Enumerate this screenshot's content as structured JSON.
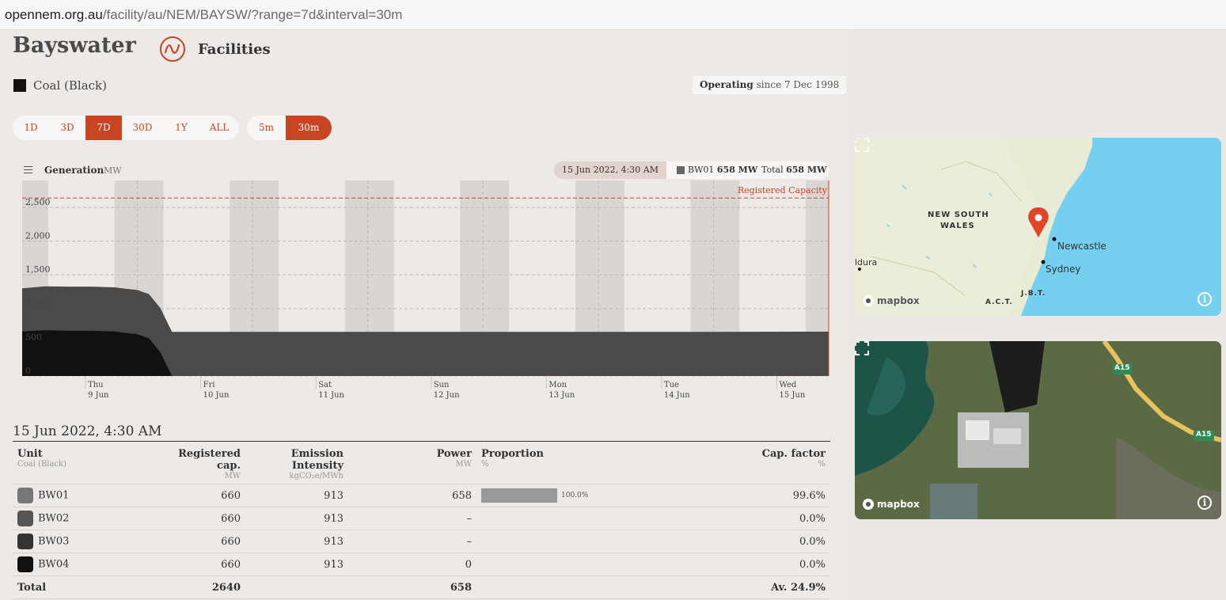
{
  "browser": {
    "url_host": "opennem.org.au",
    "url_path": "/facility/au/NEM/BAYSW/?range=7d&interval=30m"
  },
  "facility": {
    "name": "Bayswater",
    "nav_label": "Facilities",
    "fuel_tech": "Coal (Black)",
    "status": "Operating",
    "since": "since 7 Dec 1998"
  },
  "ranges": [
    "1D",
    "3D",
    "7D",
    "30D",
    "1Y",
    "ALL"
  ],
  "active_range": "7D",
  "intervals": [
    "5m",
    "30m"
  ],
  "active_interval": "30m",
  "chart_header": {
    "title": "Generation",
    "unit": "MW",
    "hover_date": "15 Jun 2022, 4:30 AM",
    "hover_unit": "BW01",
    "hover_unit_value": "658 MW",
    "hover_total_label": "Total",
    "hover_total_value": "658 MW"
  },
  "chart_data": {
    "type": "area",
    "x_ticks": [
      {
        "day": "Thu",
        "date": "9 Jun"
      },
      {
        "day": "Fri",
        "date": "10 Jun"
      },
      {
        "day": "Sat",
        "date": "11 Jun"
      },
      {
        "day": "Sun",
        "date": "12 Jun"
      },
      {
        "day": "Mon",
        "date": "13 Jun"
      },
      {
        "day": "Tue",
        "date": "14 Jun"
      },
      {
        "day": "Wed",
        "date": "15 Jun"
      }
    ],
    "y_ticks": [
      0,
      500,
      1000,
      1500,
      2000,
      2500
    ],
    "ylim": [
      0,
      2900
    ],
    "registered_capacity": 2640,
    "registered_capacity_label": "Registered Capacity",
    "x_days": [
      0,
      0.2,
      0.4,
      0.6,
      0.8,
      0.9,
      1.0,
      1.1,
      1.2,
      1.3,
      1.4,
      1.5,
      2,
      3,
      4,
      5,
      6,
      7
    ],
    "series": [
      {
        "name": "BW01",
        "color": "#4a4a4a",
        "values": [
          640,
          650,
          655,
          655,
          655,
          655,
          655,
          655,
          655,
          655,
          655,
          655,
          655,
          655,
          655,
          655,
          655,
          658
        ]
      },
      {
        "name": "BW04",
        "color": "#111111",
        "values": [
          660,
          680,
          670,
          670,
          660,
          640,
          620,
          560,
          350,
          0,
          0,
          0,
          0,
          0,
          0,
          0,
          0,
          0
        ]
      }
    ],
    "shaded_night_bands": true
  },
  "table": {
    "date": "15 Jun 2022, 4:30 AM",
    "headers": {
      "unit": "Unit",
      "unit_sub": "Coal (Black)",
      "cap": "Registered cap.",
      "cap_sub": "MW",
      "emis": "Emission Intensity",
      "emis_sub": "kgCO₂e/MWh",
      "power": "Power",
      "power_sub": "MW",
      "prop": "Proportion",
      "prop_sub": "%",
      "cf": "Cap. factor",
      "cf_sub": "%"
    },
    "rows": [
      {
        "unit": "BW01",
        "color": "#777777",
        "cap": "660",
        "emis": "913",
        "power": "658",
        "prop": 1.0,
        "prop_label": "100.0%",
        "cf": "99.6%"
      },
      {
        "unit": "BW02",
        "color": "#555555",
        "cap": "660",
        "emis": "913",
        "power": "–",
        "prop": 0,
        "prop_label": "",
        "cf": "0.0%"
      },
      {
        "unit": "BW03",
        "color": "#333333",
        "cap": "660",
        "emis": "913",
        "power": "–",
        "prop": 0,
        "prop_label": "",
        "cf": "0.0%"
      },
      {
        "unit": "BW04",
        "color": "#111111",
        "cap": "660",
        "emis": "913",
        "power": "0",
        "prop": 0,
        "prop_label": "",
        "cf": "0.0%"
      }
    ],
    "total": {
      "label": "Total",
      "cap": "2640",
      "power": "658",
      "cf": "Av. 24.9%"
    }
  },
  "map": {
    "state_label_1": "NEW SOUTH",
    "state_label_2": "WALES",
    "cities": [
      "Newcastle",
      "Sydney"
    ],
    "partial_label": "ldura",
    "act_label": "A.C.T.",
    "jbt_label": "J.B.T.",
    "attribution": "mapbox",
    "road_labels": [
      "A15",
      "A15"
    ]
  },
  "colors": {
    "accent": "#c74523",
    "sea": "#75cfee",
    "land": "#e8ecd4"
  }
}
